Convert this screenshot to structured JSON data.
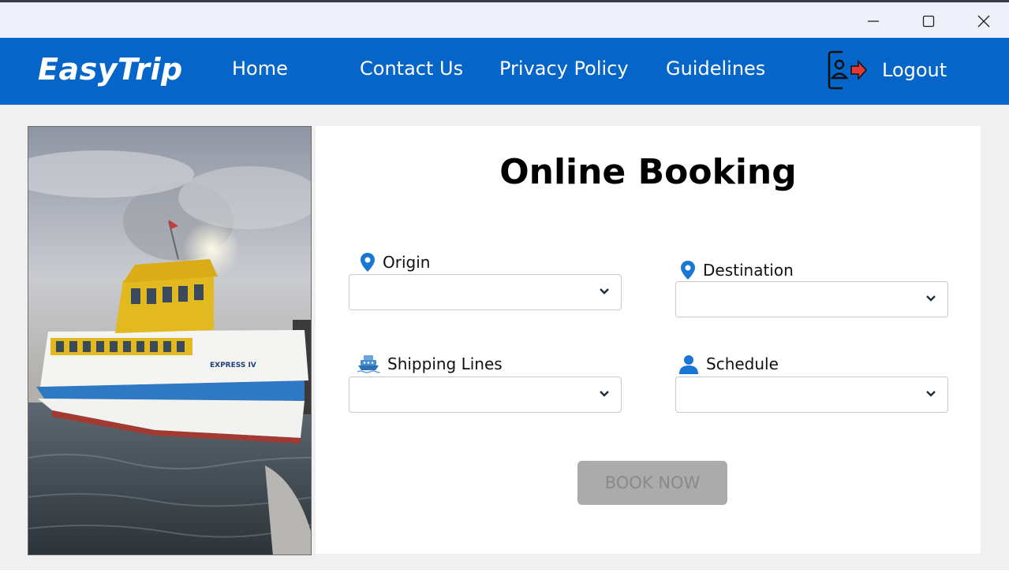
{
  "window": {
    "minimize_icon": "minimize-icon",
    "maximize_icon": "maximize-icon",
    "close_icon": "close-icon"
  },
  "nav": {
    "logo": "EasyTrip",
    "home": "Home",
    "contact": "Contact Us",
    "privacy": "Privacy Policy",
    "guidelines": "Guidelines",
    "logout": "Logout",
    "logout_icon": "logout-icon",
    "bg_color": "#0565c8"
  },
  "booking": {
    "title": "Online Booking",
    "origin": {
      "label": "Origin",
      "value": "",
      "icon": "map-pin-icon"
    },
    "destination": {
      "label": "Destination",
      "value": "",
      "icon": "map-pin-icon"
    },
    "shipping_lines": {
      "label": "Shipping Lines",
      "value": "",
      "icon": "ship-icon"
    },
    "schedule": {
      "label": "Schedule",
      "value": "",
      "icon": "user-icon"
    },
    "book_button": "BOOK NOW"
  },
  "colors": {
    "accent": "#0565c8",
    "pin": "#1976d2",
    "button_disabled": "#ababab"
  }
}
